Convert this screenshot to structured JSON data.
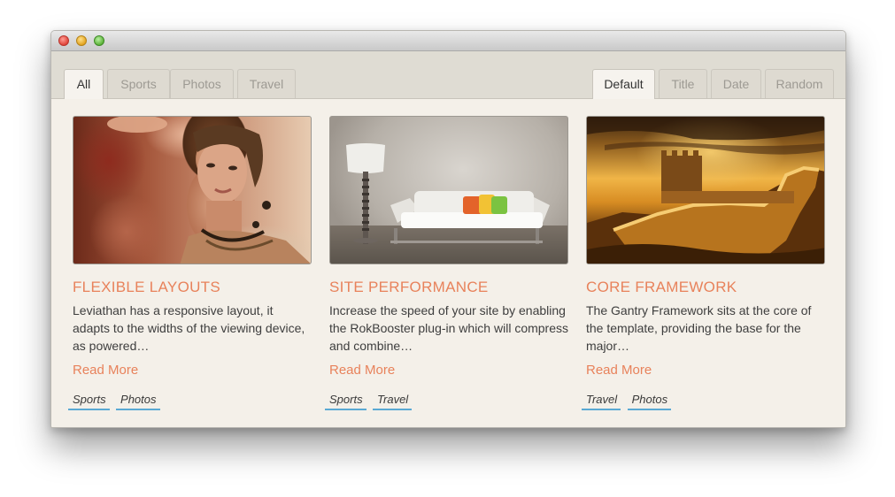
{
  "filter_tabs": [
    {
      "label": "All",
      "active": true
    },
    {
      "label": "Sports",
      "active": false
    },
    {
      "label": "Photos",
      "active": false
    },
    {
      "label": "Travel",
      "active": false
    }
  ],
  "sort_tabs": [
    {
      "label": "Default",
      "active": true
    },
    {
      "label": "Title",
      "active": false
    },
    {
      "label": "Date",
      "active": false
    },
    {
      "label": "Random",
      "active": false
    }
  ],
  "cards": [
    {
      "title": "Flexible Layouts",
      "description": "Leviathan has a responsive layout, it adapts to the widths of the viewing device, as powered…",
      "read_more": "Read More",
      "tags": [
        "Sports",
        "Photos"
      ],
      "image": "portrait-woman-photo"
    },
    {
      "title": "Site Performance",
      "description": "Increase the speed of your site by enabling the RokBooster plug-in which will compress and combine…",
      "read_more": "Read More",
      "tags": [
        "Sports",
        "Travel"
      ],
      "image": "living-room-sofa-photo"
    },
    {
      "title": "Core Framework",
      "description": "The Gantry Framework sits at the core of the template, providing the base for the major…",
      "read_more": "Read More",
      "tags": [
        "Travel",
        "Photos"
      ],
      "image": "great-wall-sunset-photo"
    }
  ],
  "colors": {
    "accent": "#e8825b",
    "tag_underline": "#5aa9d4",
    "background": "#f4f0e9",
    "tabbar": "#dfdcd3"
  }
}
